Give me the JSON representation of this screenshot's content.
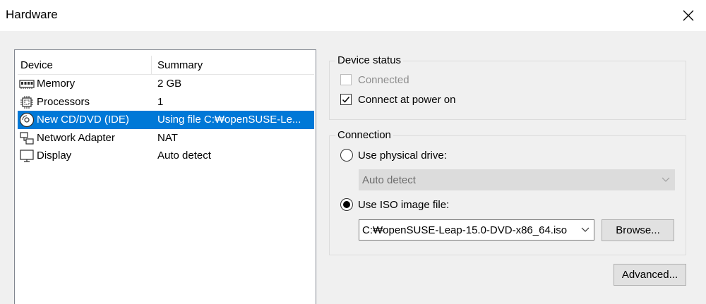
{
  "window": {
    "title": "Hardware"
  },
  "device_list": {
    "headers": {
      "device": "Device",
      "summary": "Summary"
    },
    "rows": [
      {
        "icon": "memory-icon",
        "name": "Memory",
        "summary": "2 GB",
        "selected": false
      },
      {
        "icon": "processor-icon",
        "name": "Processors",
        "summary": "1",
        "selected": false
      },
      {
        "icon": "cd-dvd-icon",
        "name": "New CD/DVD (IDE)",
        "summary": "Using file C:₩openSUSE-Le...",
        "selected": true
      },
      {
        "icon": "network-icon",
        "name": "Network Adapter",
        "summary": "NAT",
        "selected": false
      },
      {
        "icon": "display-icon",
        "name": "Display",
        "summary": "Auto detect",
        "selected": false
      }
    ]
  },
  "device_status": {
    "label": "Device status",
    "connected": {
      "label": "Connected",
      "checked": false,
      "disabled": true
    },
    "connect_at_power_on": {
      "label": "Connect at power on",
      "checked": true
    }
  },
  "connection": {
    "label": "Connection",
    "physical_drive": {
      "label": "Use physical drive:",
      "selected": false,
      "value": "Auto detect"
    },
    "iso_image": {
      "label": "Use ISO image file:",
      "selected": true,
      "value": "C:₩openSUSE-Leap-15.0-DVD-x86_64.iso"
    },
    "browse_label": "Browse..."
  },
  "advanced_label": "Advanced...",
  "colors": {
    "selection": "#0078d7",
    "window_bg": "#f0f0f0"
  }
}
